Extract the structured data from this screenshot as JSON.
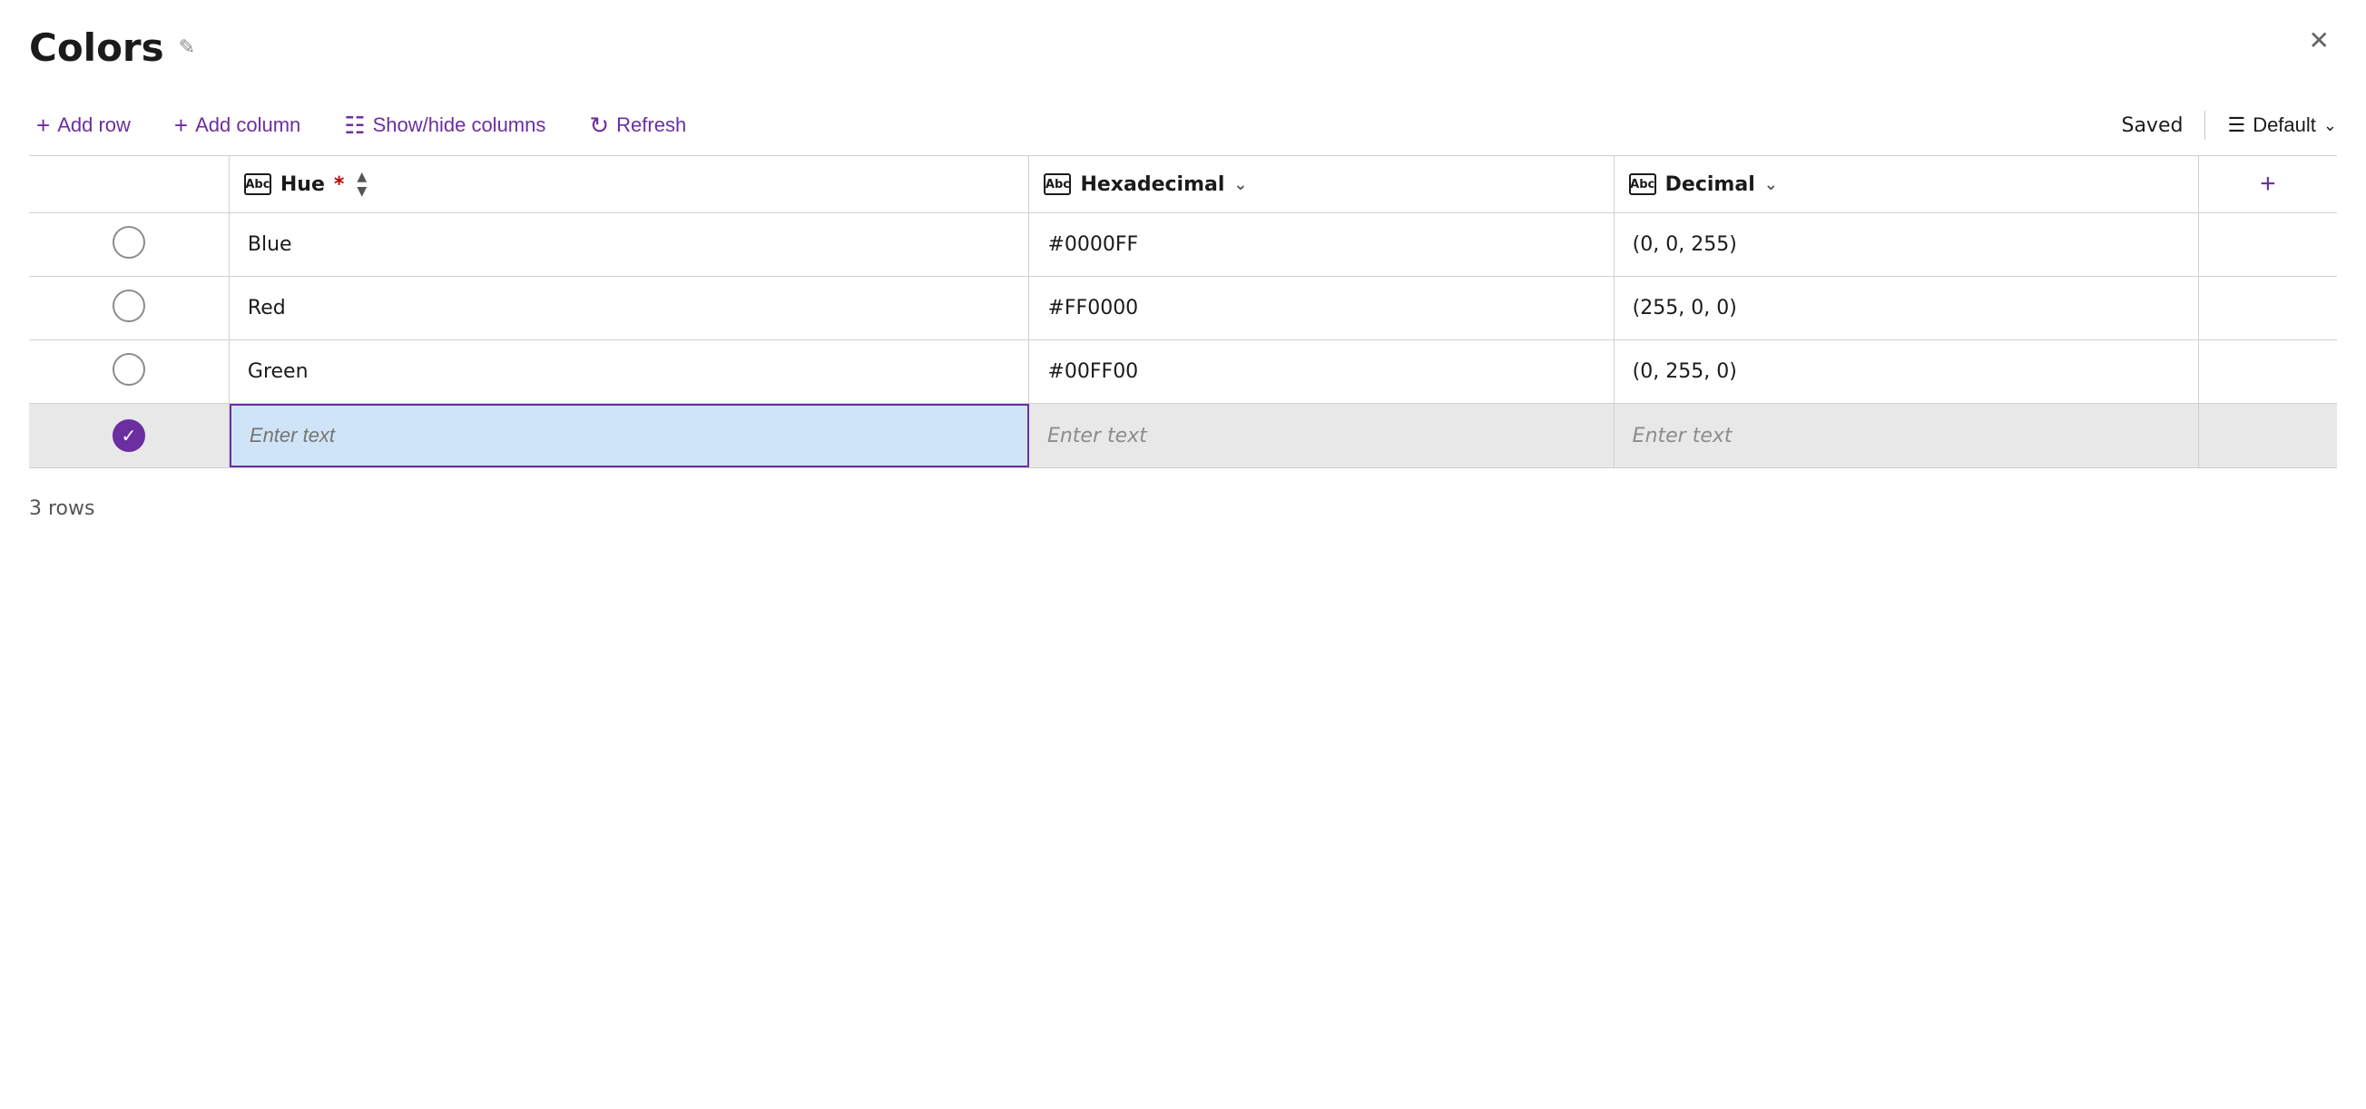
{
  "title": "Colors",
  "edit_icon": "✏",
  "close_icon": "✕",
  "toolbar": {
    "add_row_label": "Add row",
    "add_column_label": "Add column",
    "show_hide_columns_label": "Show/hide columns",
    "refresh_label": "Refresh",
    "saved_label": "Saved",
    "default_label": "Default"
  },
  "columns": [
    {
      "id": "selector",
      "label": ""
    },
    {
      "id": "hue",
      "label": "Hue",
      "required": true,
      "icon": "Abc",
      "sortable": true
    },
    {
      "id": "hexadecimal",
      "label": "Hexadecimal",
      "icon": "Abc",
      "sortable": false,
      "chevron": true
    },
    {
      "id": "decimal",
      "label": "Decimal",
      "icon": "Abc",
      "sortable": false,
      "chevron": true
    },
    {
      "id": "add",
      "label": "+"
    }
  ],
  "rows": [
    {
      "id": 1,
      "selected": false,
      "hue": "Blue",
      "hexadecimal": "#0000FF",
      "decimal": "(0, 0, 255)"
    },
    {
      "id": 2,
      "selected": false,
      "hue": "Red",
      "hexadecimal": "#FF0000",
      "decimal": "(255, 0, 0)"
    },
    {
      "id": 3,
      "selected": false,
      "hue": "Green",
      "hexadecimal": "#00FF00",
      "decimal": "(0, 255, 0)"
    }
  ],
  "new_row": {
    "selected": true,
    "hue_placeholder": "Enter text",
    "hex_placeholder": "Enter text",
    "dec_placeholder": "Enter text"
  },
  "row_count_label": "3 rows",
  "accent_color": "#6b2fa0"
}
